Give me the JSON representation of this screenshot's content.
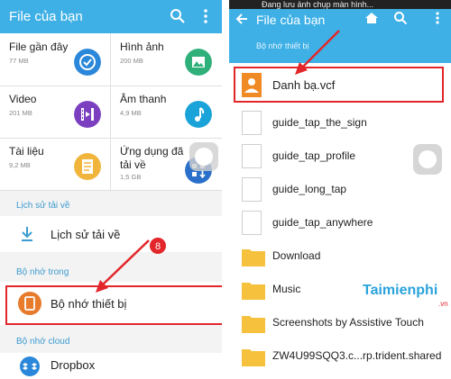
{
  "left": {
    "title": "File của bạn",
    "categories": [
      {
        "name": "File gần đây",
        "size": "77 MB",
        "icon": "clock-icon",
        "color": "#2a87d9"
      },
      {
        "name": "Hình ảnh",
        "size": "200 MB",
        "icon": "image-icon",
        "color": "#2fb07a"
      },
      {
        "name": "Video",
        "size": "201 MB",
        "icon": "film-icon",
        "color": "#7b3fbf"
      },
      {
        "name": "Âm thanh",
        "size": "4,9 MB",
        "icon": "music-note-icon",
        "color": "#1aa3d9"
      },
      {
        "name": "Tài liệu",
        "size": "9,2 MB",
        "icon": "document-icon",
        "color": "#f0b53a"
      },
      {
        "name": "Ứng dụng đã",
        "name2": "tải về",
        "size": "1,5 GB",
        "icon": "apps-download-icon",
        "color": "#2a6fc9"
      }
    ],
    "history_label": "Lịch sử tải về",
    "history_item": "Lịch sử tải về",
    "internal_label": "Bộ nhớ trong",
    "device_item": "Bộ nhớ thiết bị",
    "cloud_label": "Bộ nhớ cloud",
    "dropbox_item": "Dropbox",
    "step_badge": "8"
  },
  "right": {
    "status_text": "Đang lưu ảnh chụp màn hình...",
    "title": "File của bạn",
    "subtitle": "Bộ nhớ thiết bị",
    "files": [
      {
        "name": "Danh bạ.vcf",
        "type": "contact"
      },
      {
        "name": "guide_tap_the_sign",
        "type": "file"
      },
      {
        "name": "guide_tap_profile",
        "type": "file"
      },
      {
        "name": "guide_long_tap",
        "type": "file"
      },
      {
        "name": "guide_tap_anywhere",
        "type": "file"
      },
      {
        "name": "Download",
        "type": "folder"
      },
      {
        "name": "Music",
        "type": "folder"
      },
      {
        "name": "Screenshots by Assistive Touch",
        "type": "folder"
      },
      {
        "name": "ZW4U99SQQ3.c...rp.trident.shared",
        "type": "folder"
      }
    ],
    "watermark_brand": "Taimienphi",
    "watermark_suffix": ".vn"
  },
  "colors": {
    "accent": "#3eb0e6",
    "highlight": "#e2262a"
  }
}
